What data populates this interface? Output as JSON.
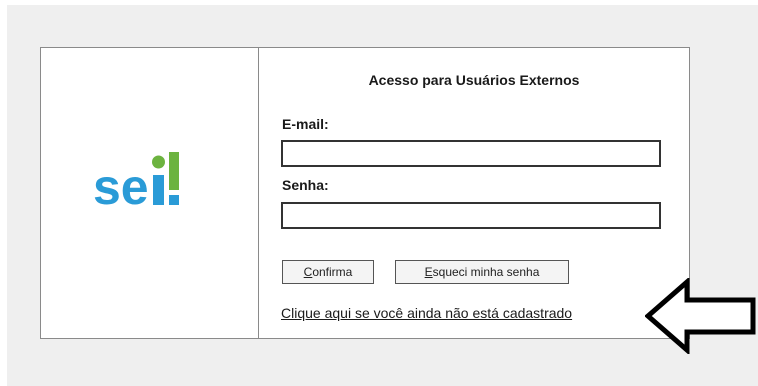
{
  "logo": {
    "text": "sei!",
    "text_color": "#2a9bd7",
    "dot_color": "#6cb33f",
    "bar_color": "#2a9bd7"
  },
  "form": {
    "title": "Acesso para Usuários Externos",
    "email_label": "E-mail:",
    "email_value": "",
    "password_label": "Senha:",
    "password_value": ""
  },
  "buttons": {
    "confirm_first": "C",
    "confirm_rest": "onfirma",
    "forgot_first": "E",
    "forgot_rest": "squeci minha senha"
  },
  "register_link": "Clique aqui se você ainda não está cadastrado",
  "annotation": {
    "icon": "left-arrow-icon",
    "stroke_color": "#000000"
  }
}
